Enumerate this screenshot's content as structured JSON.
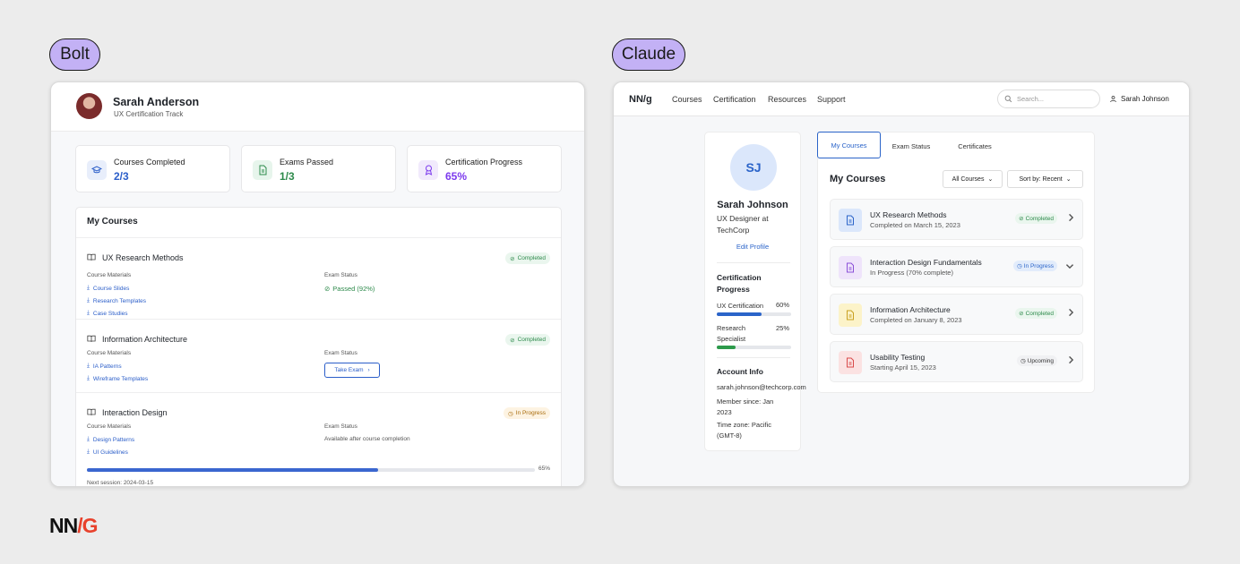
{
  "labels": {
    "left": "Bolt",
    "right": "Claude",
    "footer_logo": "NN/G"
  },
  "bolt": {
    "user": {
      "name": "Sarah Anderson",
      "track": "UX Certification Track"
    },
    "stats": [
      {
        "label": "Courses Completed",
        "value": "2/3",
        "icon": "graduation-cap-icon",
        "color": "#2b5ec9"
      },
      {
        "label": "Exams Passed",
        "value": "1/3",
        "icon": "document-icon",
        "color": "#2d8a4b"
      },
      {
        "label": "Certification Progress",
        "value": "65%",
        "icon": "award-icon",
        "color": "#7c3aed"
      }
    ],
    "section_title": "My Courses",
    "courses": [
      {
        "title": "UX Research Methods",
        "status": "Completed",
        "materials_label": "Course Materials",
        "materials": [
          "Course Slides",
          "Research Templates",
          "Case Studies"
        ],
        "exam_label": "Exam Status",
        "exam": "Passed (92%)"
      },
      {
        "title": "Information Architecture",
        "status": "Completed",
        "materials_label": "Course Materials",
        "materials": [
          "IA Patterns",
          "Wireframe Templates"
        ],
        "exam_label": "Exam Status",
        "exam_button": "Take Exam"
      },
      {
        "title": "Interaction Design",
        "status": "In Progress",
        "materials_label": "Course Materials",
        "materials": [
          "Design Patterns",
          "UI Guidelines"
        ],
        "exam_label": "Exam Status",
        "exam": "Available after course completion",
        "progress": 0.65,
        "progress_label": "65%",
        "next": "Next session: 2024-03-15"
      }
    ]
  },
  "claude": {
    "logo": "NN/g",
    "nav": [
      "Courses",
      "Certification",
      "Resources",
      "Support"
    ],
    "search_placeholder": "Search...",
    "user_name": "Sarah Johnson",
    "profile": {
      "initials": "SJ",
      "name": "Sarah Johnson",
      "role": "UX Designer at TechCorp",
      "edit": "Edit Profile"
    },
    "cert": {
      "title": "Certification Progress",
      "items": [
        {
          "label": "UX Certification",
          "pct": "60%",
          "value": 0.6,
          "color": "#2b64c9"
        },
        {
          "label": "Research Specialist",
          "pct": "25%",
          "value": 0.25,
          "color": "#2d9a4b"
        }
      ]
    },
    "account": {
      "title": "Account Info",
      "email": "sarah.johnson@techcorp.com",
      "member": "Member since: Jan 2023",
      "timezone": "Time zone: Pacific (GMT-8)"
    },
    "tabs": [
      "My Courses",
      "Exam Status",
      "Certificates"
    ],
    "main_title": "My Courses",
    "filter": "All Courses",
    "sort": "Sort by: Recent",
    "courses": [
      {
        "title": "UX Research Methods",
        "sub": "Completed on March 15, 2023",
        "status": "Completed",
        "icon_bg": "#dbe7fb",
        "icon_color": "#2b64c9",
        "arrow": "chevron-right-icon"
      },
      {
        "title": "Interaction Design Fundamentals",
        "sub": "In Progress (70% complete)",
        "status": "In Progress",
        "icon_bg": "#efe4fb",
        "icon_color": "#8b4fd8",
        "arrow": "chevron-down-icon"
      },
      {
        "title": "Information Architecture",
        "sub": "Completed on January 8, 2023",
        "status": "Completed",
        "icon_bg": "#fcf3c9",
        "icon_color": "#c9a020",
        "arrow": "chevron-right-icon"
      },
      {
        "title": "Usability Testing",
        "sub": "Starting April 15, 2023",
        "status": "Upcoming",
        "icon_bg": "#fbe2e2",
        "icon_color": "#d94a4a",
        "arrow": "chevron-right-icon"
      }
    ]
  }
}
